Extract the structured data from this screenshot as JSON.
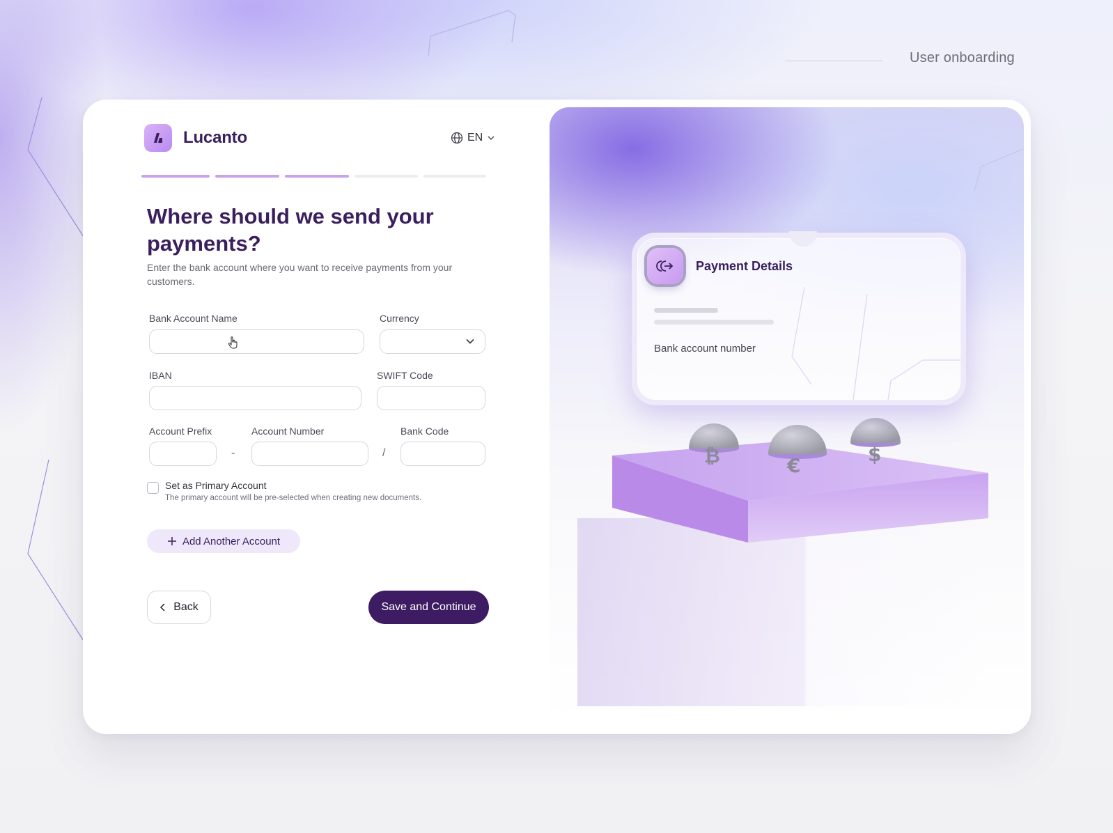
{
  "page": {
    "top_label": "User onboarding"
  },
  "brand": {
    "name": "Lucanto"
  },
  "language": {
    "selected": "EN"
  },
  "progress": {
    "steps_total": 5,
    "steps_completed": 3
  },
  "form": {
    "title": "Where should we send your payments?",
    "subtitle": "Enter the bank account where you want to receive payments from your customers.",
    "fields": {
      "bank_account_name": {
        "label": "Bank Account Name",
        "value": ""
      },
      "currency": {
        "label": "Currency",
        "value": ""
      },
      "iban": {
        "label": "IBAN",
        "value": ""
      },
      "swift": {
        "label": "SWIFT Code",
        "value": ""
      },
      "account_prefix": {
        "label": "Account Prefix",
        "value": ""
      },
      "account_number": {
        "label": "Account Number",
        "value": ""
      },
      "bank_code": {
        "label": "Bank Code",
        "value": ""
      }
    },
    "separators": {
      "prefix_number": "-",
      "number_code": "/"
    },
    "primary": {
      "label": "Set as Primary Account",
      "hint": "The primary account will be pre-selected when creating new documents.",
      "checked": false
    },
    "add_account_label": "Add Another Account",
    "back_label": "Back",
    "save_label": "Save and Continue"
  },
  "illustration": {
    "card_title": "Payment Details",
    "card_field_label": "Bank account number",
    "coins": [
      "₿",
      "€",
      "$"
    ]
  },
  "colors": {
    "brand_dark": "#3d1c63",
    "accent": "#c9a2ee",
    "accent_soft": "#efe8fb",
    "text_dark": "#3a1f5d"
  }
}
